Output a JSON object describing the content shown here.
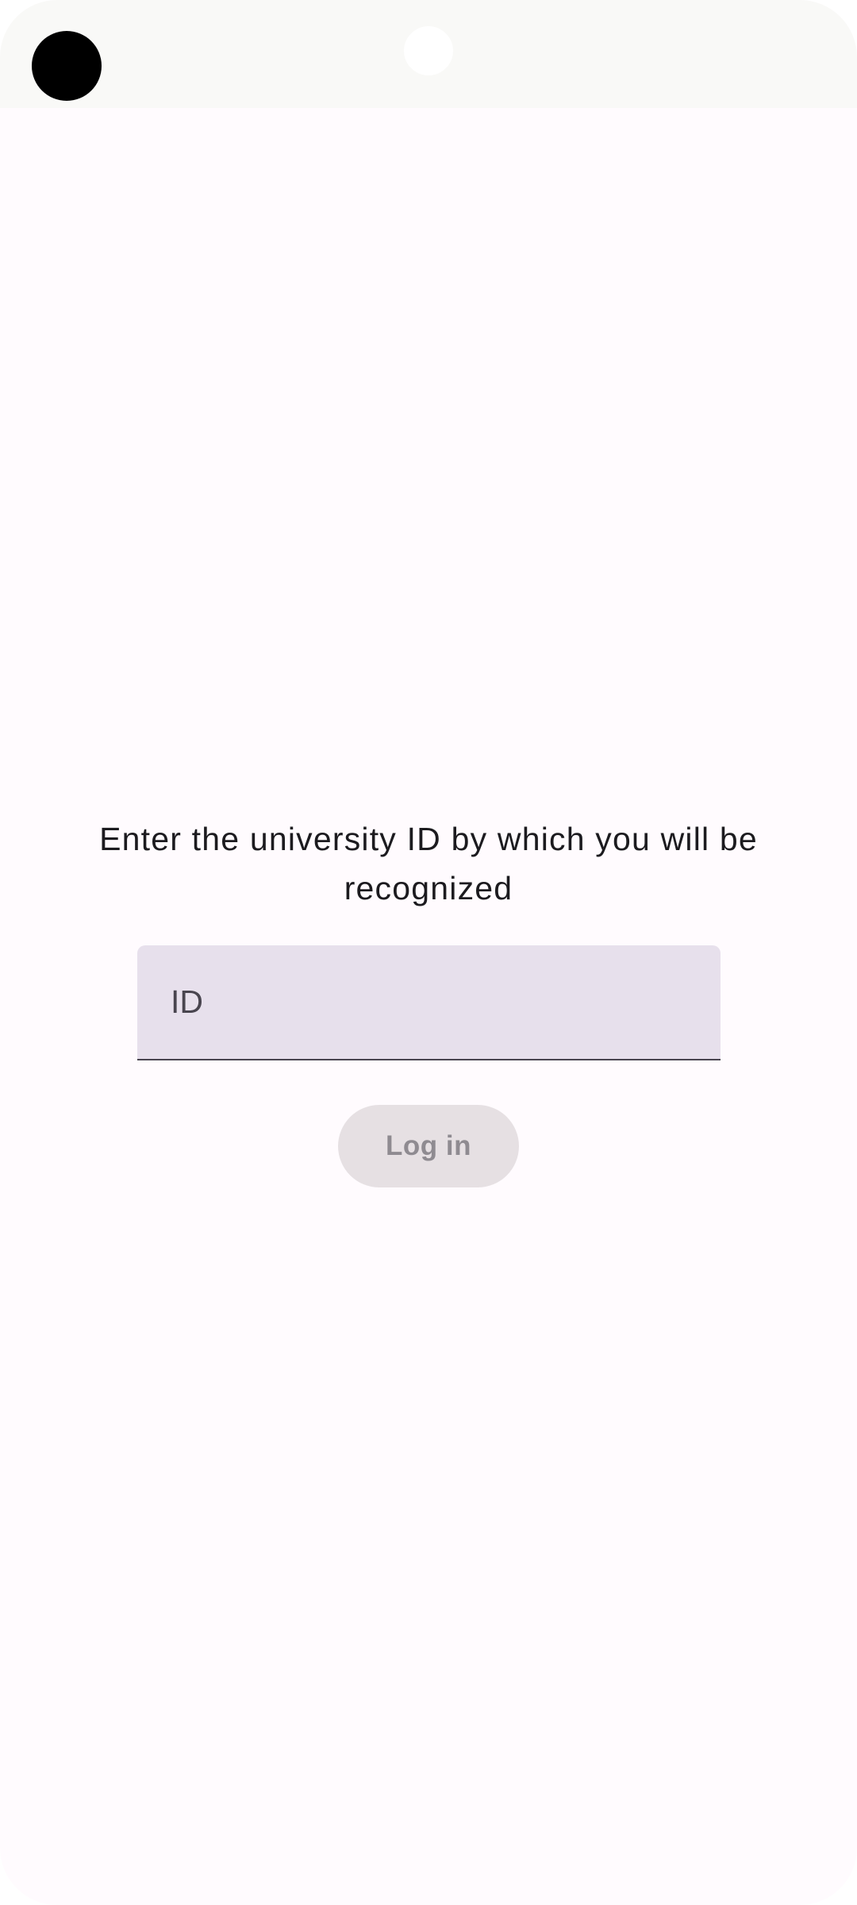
{
  "screen": {
    "prompt": "Enter the university ID by which you will be recognized",
    "id_field": {
      "value": "",
      "placeholder": "ID"
    },
    "login_button": {
      "label": "Log in",
      "enabled": false
    }
  },
  "colors": {
    "background": "#fffbfe",
    "status_bar": "#f9f9f7",
    "field_fill": "#e7e0ec",
    "field_underline": "#49454f",
    "text_primary": "#1c1b1f",
    "button_disabled_fill": "#e6e0e3",
    "button_disabled_text": "#8f8b91"
  }
}
